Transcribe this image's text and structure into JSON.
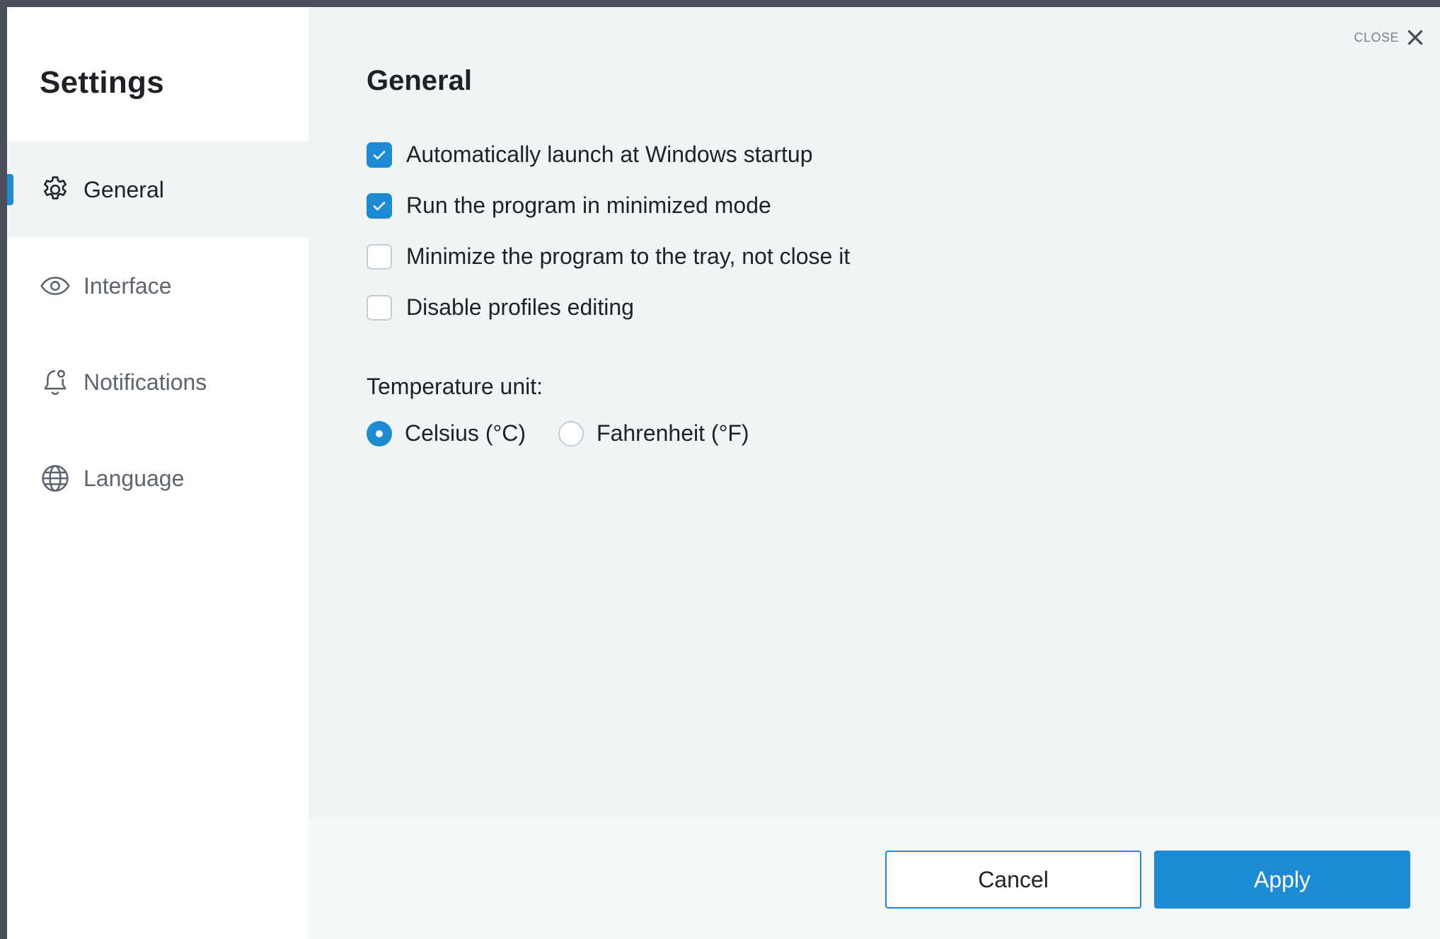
{
  "sidebar": {
    "title": "Settings",
    "items": [
      {
        "label": "General",
        "icon": "gear-icon",
        "active": true
      },
      {
        "label": "Interface",
        "icon": "eye-icon",
        "active": false
      },
      {
        "label": "Notifications",
        "icon": "bell-icon",
        "active": false
      },
      {
        "label": "Language",
        "icon": "globe-icon",
        "active": false
      }
    ]
  },
  "header": {
    "close_label": "CLOSE"
  },
  "main": {
    "title": "General",
    "options": [
      {
        "label": "Automatically launch at Windows startup",
        "checked": true
      },
      {
        "label": "Run the program in minimized mode",
        "checked": true
      },
      {
        "label": "Minimize the program to the tray, not close it",
        "checked": false
      },
      {
        "label": "Disable profiles editing",
        "checked": false
      }
    ],
    "temperature": {
      "label": "Temperature unit:",
      "options": [
        {
          "label": "Celsius (°C)",
          "selected": true
        },
        {
          "label": "Fahrenheit (°F)",
          "selected": false
        }
      ]
    }
  },
  "footer": {
    "cancel_label": "Cancel",
    "apply_label": "Apply"
  },
  "colors": {
    "accent": "#1c8bd3",
    "sidebar_bg": "#ffffff",
    "content_bg": "#f0f4f5"
  }
}
